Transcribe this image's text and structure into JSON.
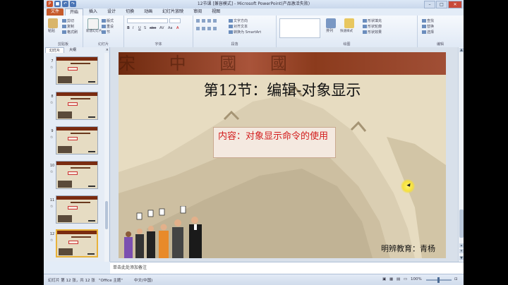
{
  "window": {
    "title": "12节课 [兼容模式] - Microsoft PowerPoint(产品激活失败)",
    "controls": [
      "–",
      "□",
      "✕"
    ]
  },
  "tabs": [
    "文件",
    "开始",
    "插入",
    "设计",
    "切换",
    "动画",
    "幻灯片放映",
    "审阅",
    "视图"
  ],
  "ribbon": {
    "clipboard": {
      "label": "剪贴板",
      "paste": "粘贴",
      "cut": "剪切",
      "copy": "复制",
      "format_painter": "格式刷"
    },
    "slides": {
      "label": "幻灯片",
      "new_slide": "新建幻灯片",
      "layout": "版式",
      "reset": "重设",
      "section": "节"
    },
    "font": {
      "label": "字体",
      "bold": "B",
      "italic": "I",
      "underline": "U",
      "shadow": "S",
      "strike": "abe",
      "spacing": "AV",
      "case": "Aa",
      "color": "A"
    },
    "paragraph": {
      "label": "段落",
      "text_dir": "文字方向",
      "align_text": "对齐文本",
      "smartart": "转换为 SmartArt"
    },
    "drawing": {
      "label": "绘图",
      "arrange": "排列",
      "quick_styles": "快速样式",
      "fill": "形状填充",
      "outline": "形状轮廓",
      "effects": "形状效果"
    },
    "editing": {
      "label": "编辑",
      "find": "查找",
      "replace": "替换",
      "select": "选择"
    }
  },
  "pane": {
    "tabs": [
      "幻灯片",
      "大纲"
    ],
    "close": "×",
    "thumbnails": [
      {
        "num": "7"
      },
      {
        "num": "8"
      },
      {
        "num": "9"
      },
      {
        "num": "10"
      },
      {
        "num": "11"
      },
      {
        "num": "12"
      }
    ]
  },
  "slide": {
    "banner_text": "宋 中 國 國",
    "title": "第12节：编辑-对象显示",
    "content": "内容：对象显示命令的使用",
    "footer": "明辨教育：青杨"
  },
  "notes": {
    "placeholder": "单击此处添加备注"
  },
  "status": {
    "slide_info": "幻灯片 第 12 张，共 12 张",
    "theme": "\"Office 主题\"",
    "language": "中文(中国)",
    "zoom": "100%"
  },
  "colors": {
    "file_tab": "#c65a2b",
    "banner": "#7a2b10",
    "content_text": "#d21c1c",
    "selected_thumb": "#e8b23a"
  }
}
